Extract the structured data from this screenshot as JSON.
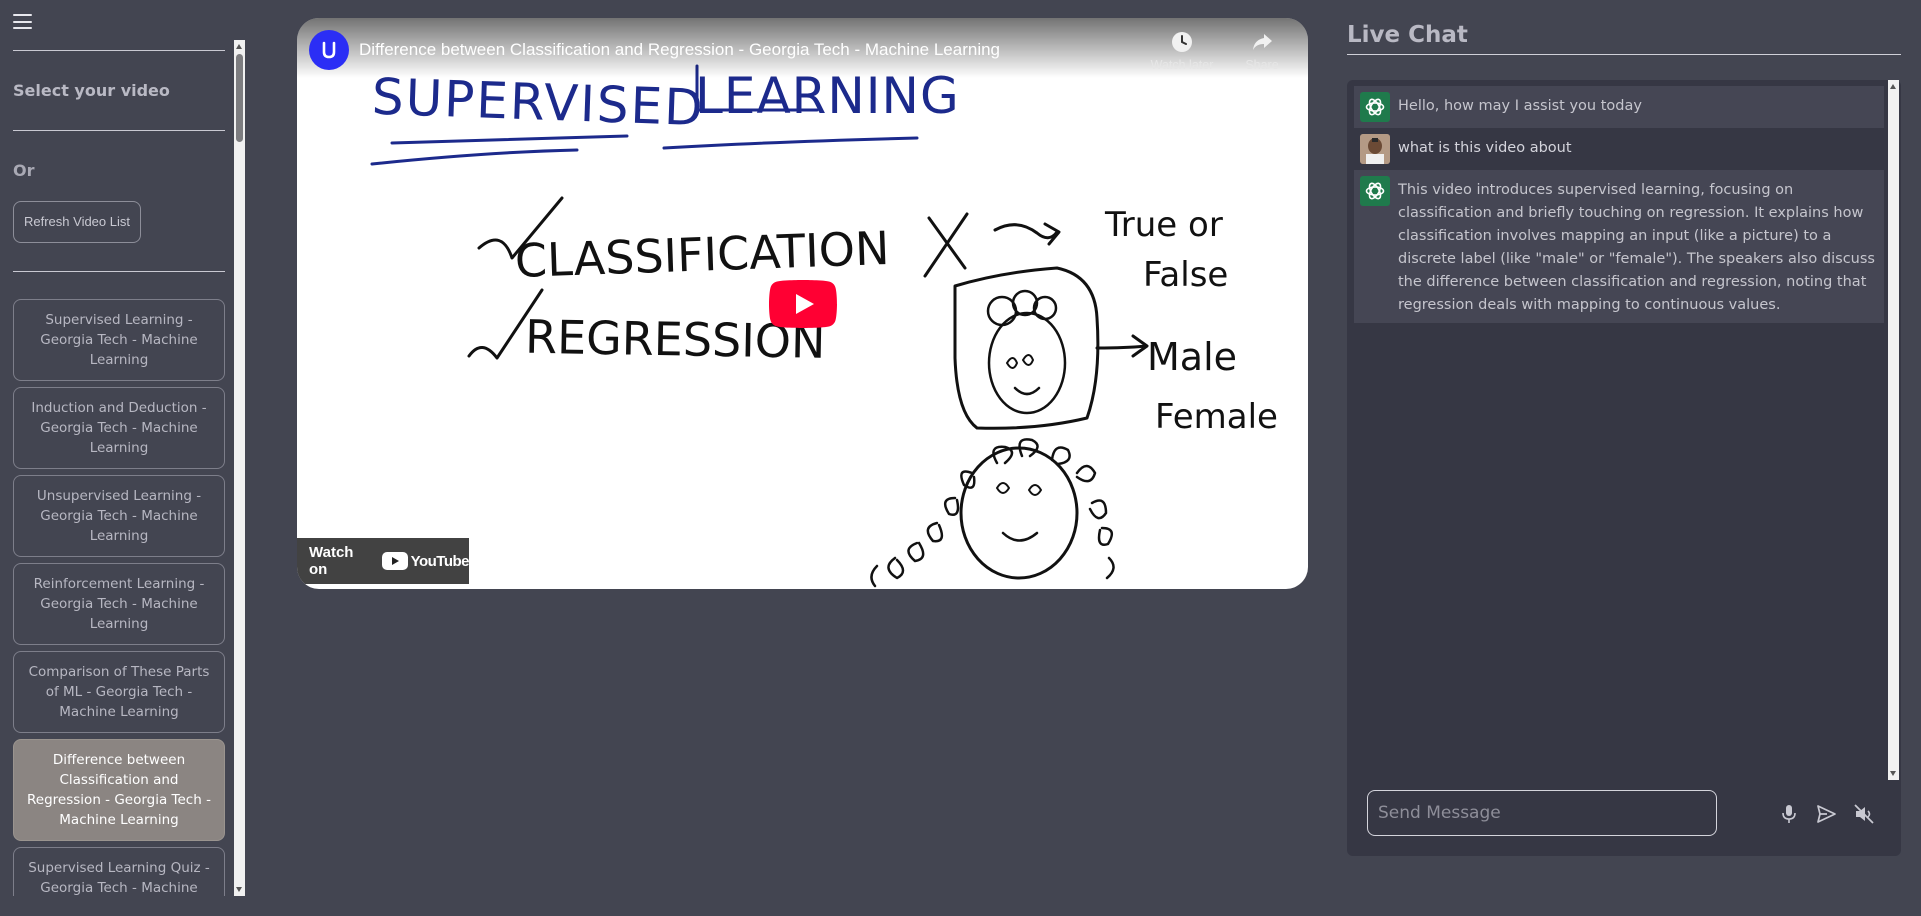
{
  "sidebar": {
    "select_title": "Select your video",
    "or_label": "Or",
    "refresh_label": "Refresh Video List",
    "videos": [
      "Supervised Learning - Georgia Tech - Machine Learning",
      "Induction and Deduction - Georgia Tech - Machine Learning",
      "Unsupervised Learning - Georgia Tech - Machine Learning",
      "Reinforcement Learning - Georgia Tech - Machine Learning",
      "Comparison of These Parts of ML - Georgia Tech - Machine Learning",
      "Difference between Classification and Regression - Georgia Tech - Machine Learning",
      "Supervised Learning Quiz - Georgia Tech - Machine Learning"
    ],
    "active_index": 5
  },
  "video": {
    "title": "Difference between Classification and Regression - Georgia Tech - Machine Learning",
    "watch_later": "Watch later",
    "share": "Share",
    "watch_on": "Watch on",
    "youtube_word": "YouTube",
    "whiteboard": {
      "heading_left": "SUPERVISED",
      "heading_right": "LEARNING",
      "item1": "CLASSIFICATION",
      "item2": "REGRESSION",
      "x_label": "X",
      "true_or": "True or",
      "false": "False",
      "male": "Male",
      "female": "Female"
    },
    "colors": {
      "ink_blue": "#1c2a8c",
      "ink_black": "#111111",
      "play_red": "#ff0033"
    }
  },
  "chat": {
    "title": "Live Chat",
    "messages": [
      {
        "role": "bot",
        "text": "Hello, how may I assist you today"
      },
      {
        "role": "user",
        "text": "what is this video about"
      },
      {
        "role": "bot",
        "text": "This video introduces supervised learning, focusing on classification and briefly touching on regression. It explains how classification involves mapping an input (like a picture) to a discrete label (like \"male\" or \"female\"). The speakers also discuss the difference between classification and regression, noting that regression deals with mapping to continuous values."
      }
    ],
    "input_placeholder": "Send Message",
    "icons": [
      "mic-icon",
      "send-icon",
      "speaker-muted-icon"
    ]
  }
}
